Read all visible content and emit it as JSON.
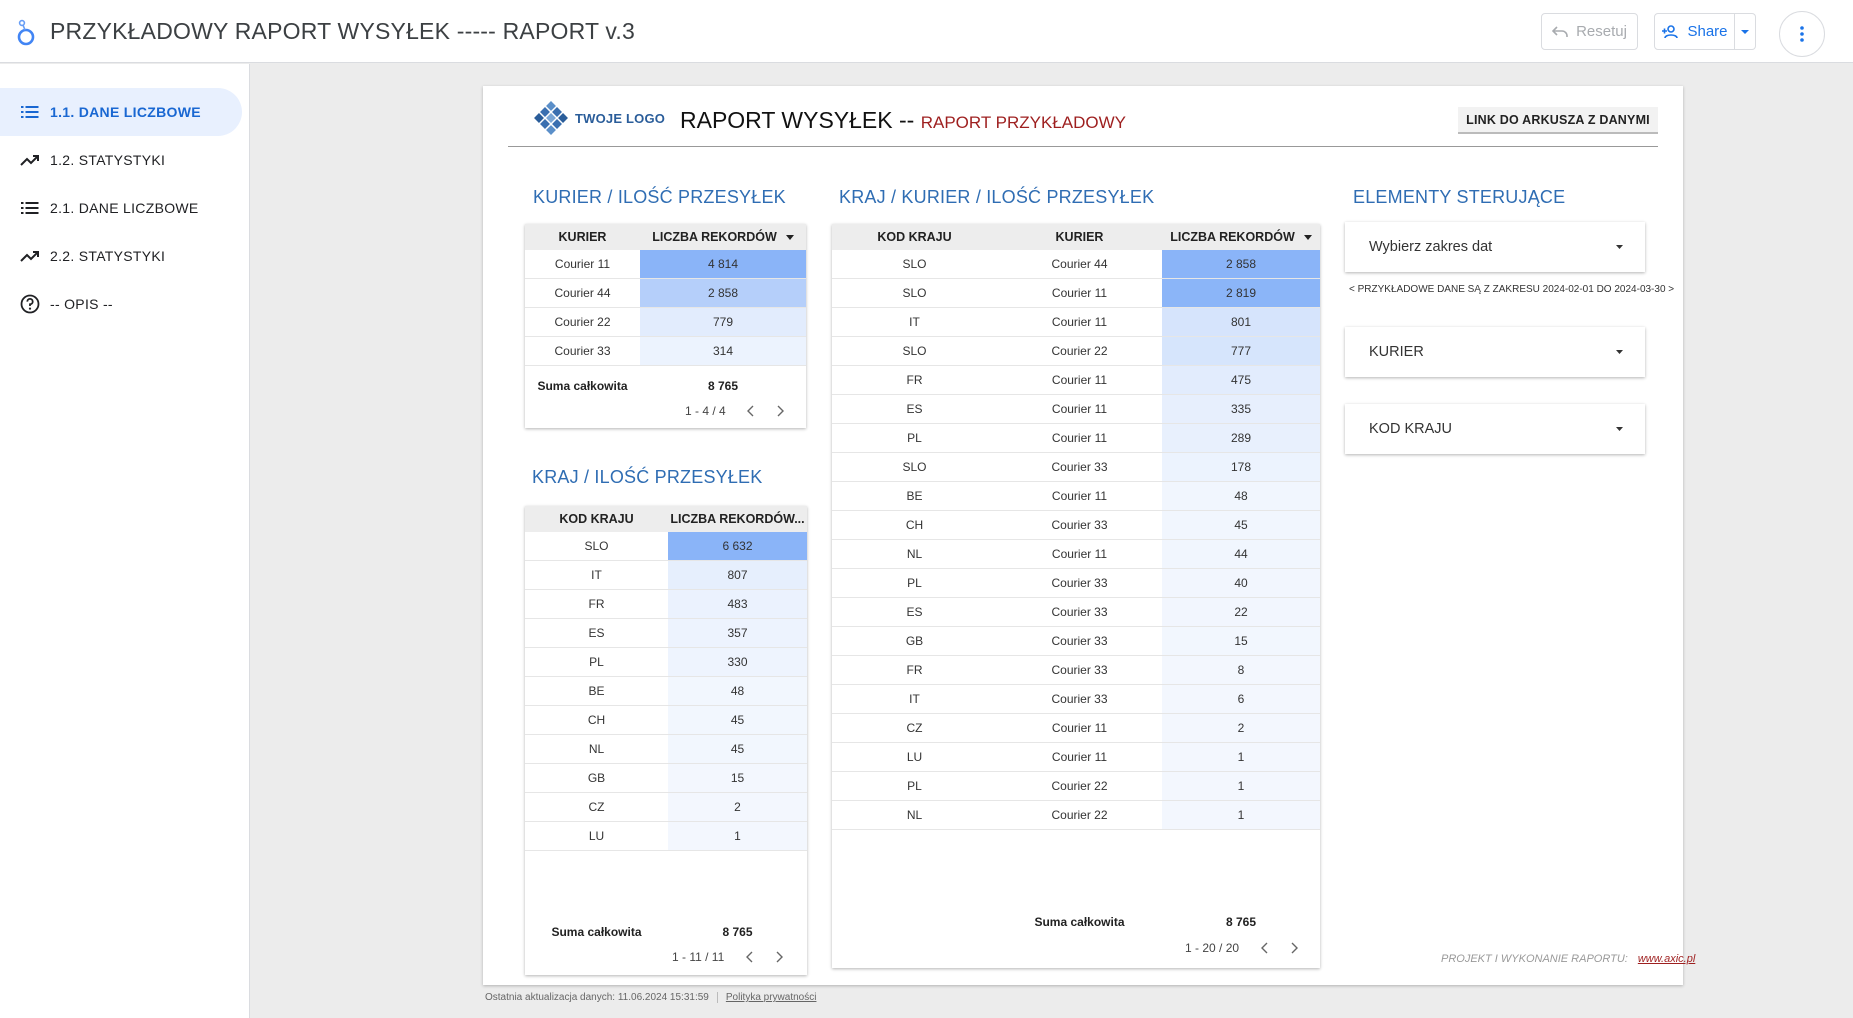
{
  "app": {
    "title": "PRZYKŁADOWY RAPORT WYSYŁEK ----- RAPORT v.3",
    "reset_label": "Resetuj",
    "share_label": "Share"
  },
  "sidebar": {
    "items": [
      {
        "label": "1.1. DANE LICZBOWE",
        "icon": "list-icon",
        "active": true
      },
      {
        "label": "1.2. STATYSTYKI",
        "icon": "trending-up-icon",
        "active": false
      },
      {
        "label": "2.1. DANE LICZBOWE",
        "icon": "list-icon",
        "active": false
      },
      {
        "label": "2.2. STATYSTYKI",
        "icon": "trending-up-icon",
        "active": false
      },
      {
        "label": "-- OPIS --",
        "icon": "help-icon",
        "active": false
      }
    ]
  },
  "report": {
    "logo_text": "TWOJE LOGO",
    "title": "RAPORT WYSYŁEK --",
    "subtitle": "RAPORT PRZYKŁADOWY",
    "link_button": "LINK DO ARKUSZA Z DANYMI",
    "credit_text": "PROJEKT I WYKONANIE RAPORTU:",
    "credit_link": "www.axic.pl"
  },
  "colors": {
    "accent": "#1967d2",
    "section_title": "#2f6db3",
    "subtitle_red": "#9e1f1f",
    "heat_high": "#8ab4f8"
  },
  "table_kurier": {
    "title": "KURIER / ILOŚĆ PRZESYŁEK",
    "headers": [
      "KURIER",
      "LICZBA REKORDÓW"
    ],
    "rows": [
      {
        "kurier": "Courier 11",
        "count": "4 814",
        "value": 4814
      },
      {
        "kurier": "Courier 44",
        "count": "2 858",
        "value": 2858
      },
      {
        "kurier": "Courier 22",
        "count": "779",
        "value": 779
      },
      {
        "kurier": "Courier 33",
        "count": "314",
        "value": 314
      }
    ],
    "total_label": "Suma całkowita",
    "total_value": "8 765",
    "pager": "1 - 4 / 4"
  },
  "table_kraj": {
    "title": "KRAJ / ILOŚĆ PRZESYŁEK",
    "headers": [
      "KOD KRAJU",
      "LICZBA REKORDÓW..."
    ],
    "rows": [
      {
        "kraj": "SLO",
        "count": "6 632",
        "value": 6632
      },
      {
        "kraj": "IT",
        "count": "807",
        "value": 807
      },
      {
        "kraj": "FR",
        "count": "483",
        "value": 483
      },
      {
        "kraj": "ES",
        "count": "357",
        "value": 357
      },
      {
        "kraj": "PL",
        "count": "330",
        "value": 330
      },
      {
        "kraj": "BE",
        "count": "48",
        "value": 48
      },
      {
        "kraj": "CH",
        "count": "45",
        "value": 45
      },
      {
        "kraj": "NL",
        "count": "45",
        "value": 45
      },
      {
        "kraj": "GB",
        "count": "15",
        "value": 15
      },
      {
        "kraj": "CZ",
        "count": "2",
        "value": 2
      },
      {
        "kraj": "LU",
        "count": "1",
        "value": 1
      }
    ],
    "total_label": "Suma całkowita",
    "total_value": "8 765",
    "pager": "1 - 11 / 11"
  },
  "table_kraj_kurier": {
    "title": "KRAJ / KURIER / ILOŚĆ PRZESYŁEK",
    "headers": [
      "KOD KRAJU",
      "KURIER",
      "LICZBA REKORDÓW"
    ],
    "rows": [
      {
        "kraj": "SLO",
        "kurier": "Courier 44",
        "count": "2 858",
        "value": 2858
      },
      {
        "kraj": "SLO",
        "kurier": "Courier 11",
        "count": "2 819",
        "value": 2819
      },
      {
        "kraj": "IT",
        "kurier": "Courier 11",
        "count": "801",
        "value": 801
      },
      {
        "kraj": "SLO",
        "kurier": "Courier 22",
        "count": "777",
        "value": 777
      },
      {
        "kraj": "FR",
        "kurier": "Courier 11",
        "count": "475",
        "value": 475
      },
      {
        "kraj": "ES",
        "kurier": "Courier 11",
        "count": "335",
        "value": 335
      },
      {
        "kraj": "PL",
        "kurier": "Courier 11",
        "count": "289",
        "value": 289
      },
      {
        "kraj": "SLO",
        "kurier": "Courier 33",
        "count": "178",
        "value": 178
      },
      {
        "kraj": "BE",
        "kurier": "Courier 11",
        "count": "48",
        "value": 48
      },
      {
        "kraj": "CH",
        "kurier": "Courier 33",
        "count": "45",
        "value": 45
      },
      {
        "kraj": "NL",
        "kurier": "Courier 11",
        "count": "44",
        "value": 44
      },
      {
        "kraj": "PL",
        "kurier": "Courier 33",
        "count": "40",
        "value": 40
      },
      {
        "kraj": "ES",
        "kurier": "Courier 33",
        "count": "22",
        "value": 22
      },
      {
        "kraj": "GB",
        "kurier": "Courier 33",
        "count": "15",
        "value": 15
      },
      {
        "kraj": "FR",
        "kurier": "Courier 33",
        "count": "8",
        "value": 8
      },
      {
        "kraj": "IT",
        "kurier": "Courier 33",
        "count": "6",
        "value": 6
      },
      {
        "kraj": "CZ",
        "kurier": "Courier 11",
        "count": "2",
        "value": 2
      },
      {
        "kraj": "LU",
        "kurier": "Courier 11",
        "count": "1",
        "value": 1
      },
      {
        "kraj": "PL",
        "kurier": "Courier 22",
        "count": "1",
        "value": 1
      },
      {
        "kraj": "NL",
        "kurier": "Courier 22",
        "count": "1",
        "value": 1
      }
    ],
    "total_label": "Suma całkowita",
    "total_value": "8 765",
    "pager": "1 - 20 / 20"
  },
  "controls": {
    "title": "ELEMENTY STERUJĄCE",
    "date_range": "Wybierz zakres dat",
    "date_note": "< PRZYKŁADOWE DANE SĄ Z ZAKRESU 2024-02-01 DO 2024-03-30 >",
    "kurier": "KURIER",
    "kod_kraju": "KOD KRAJU"
  },
  "footer": {
    "last_update": "Ostatnia aktualizacja danych: 11.06.2024 15:31:59",
    "privacy": "Polityka prywatności"
  }
}
